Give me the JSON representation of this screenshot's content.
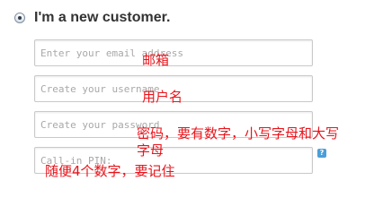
{
  "form": {
    "radio_label": "I'm a new customer.",
    "radio_checked": true,
    "fields": {
      "email": {
        "placeholder": "Enter your email address",
        "value": ""
      },
      "username": {
        "placeholder": "Create your username",
        "value": ""
      },
      "password": {
        "placeholder": "Create your password",
        "value": ""
      },
      "pin": {
        "placeholder": "Call-in PIN:",
        "value": ""
      }
    },
    "help_icon": "question-icon",
    "help_glyph": "?"
  },
  "annotations": {
    "email": "邮箱",
    "username": "用户名",
    "password_line1": "密码，要有数字，小写字母和大写",
    "password_line2": "字母",
    "pin": "随便4个数字，要记住"
  },
  "colors": {
    "annotation": "#e8141b",
    "title": "#333333",
    "help_badge": "#4a9fd8"
  }
}
